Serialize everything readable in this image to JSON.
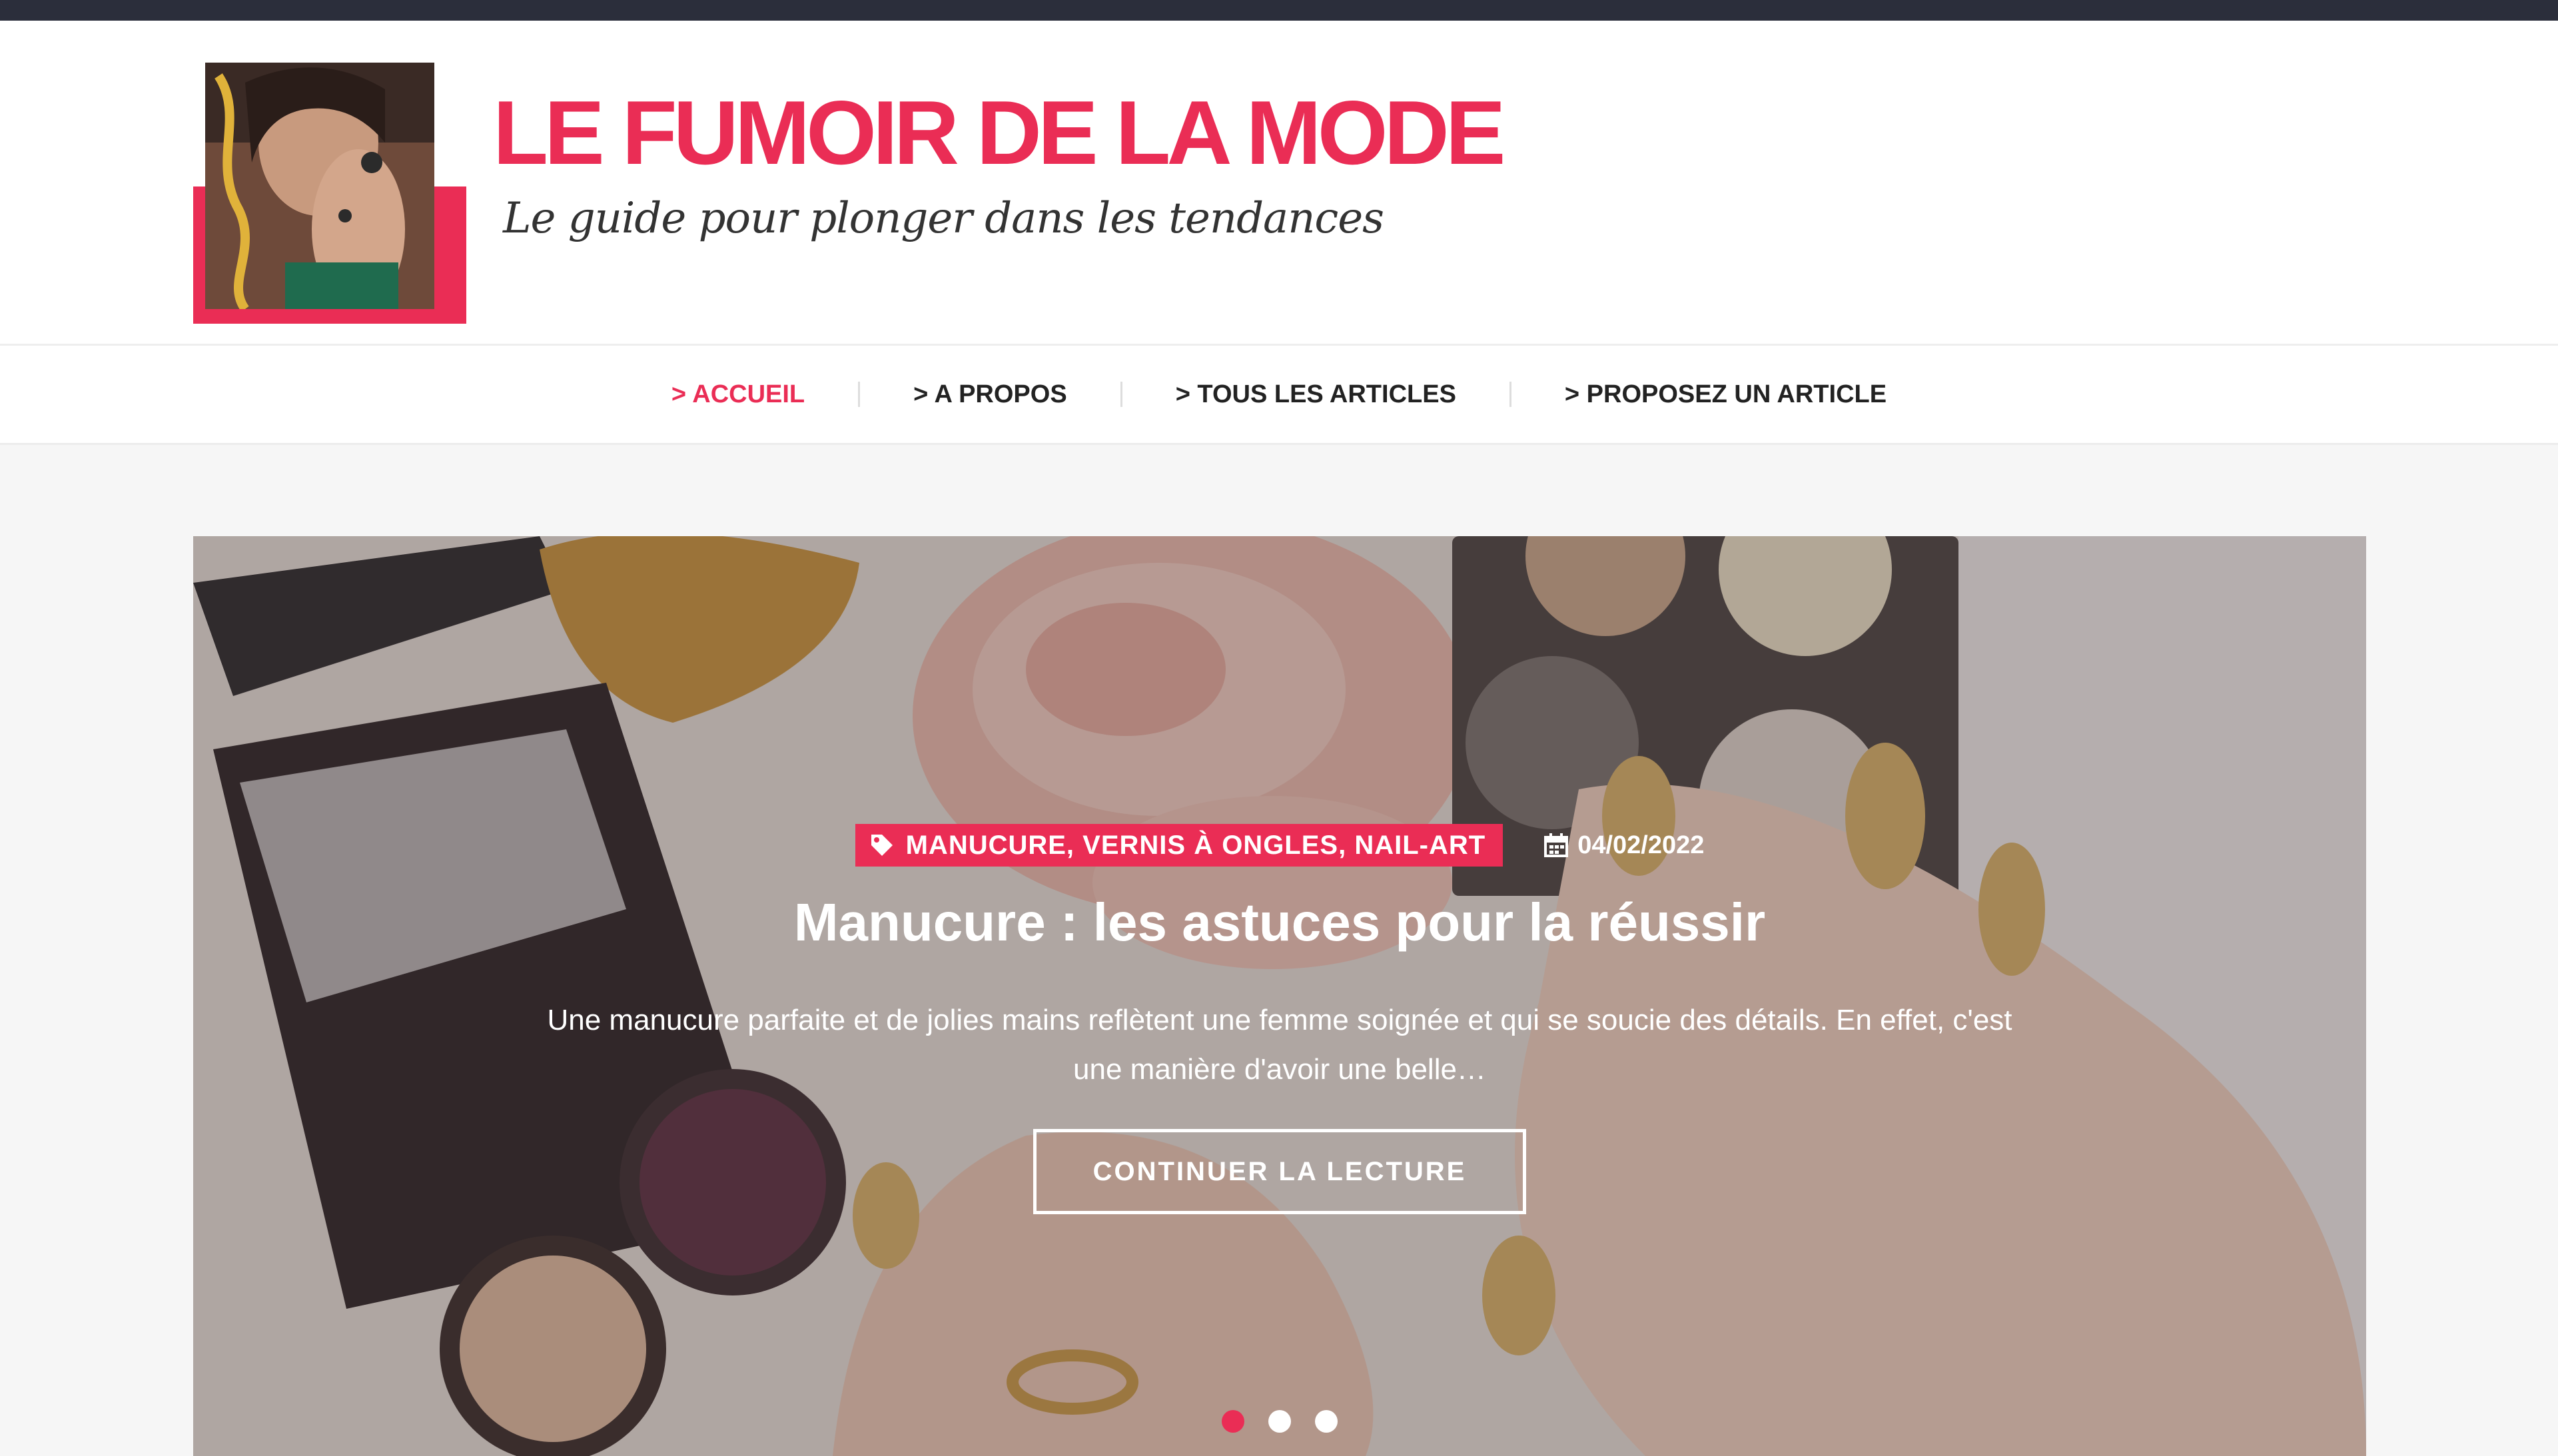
{
  "site": {
    "title": "LE FUMOIR DE LA MODE",
    "tagline": "Le guide pour plonger dans les tendances"
  },
  "nav": {
    "items": [
      {
        "label": "> ACCUEIL",
        "active": true
      },
      {
        "label": "> A PROPOS",
        "active": false
      },
      {
        "label": "> TOUS LES ARTICLES",
        "active": false
      },
      {
        "label": "> PROPOSEZ UN ARTICLE",
        "active": false
      }
    ]
  },
  "slide": {
    "categories": "MANUCURE, VERNIS À ONGLES, NAIL-ART",
    "date": "04/02/2022",
    "title": "Manucure : les astuces pour la réussir",
    "excerpt": "Une manucure parfaite et de jolies mains reflètent une femme soignée et qui se soucie des détails. En effet, c'est une manière d'avoir une belle…",
    "button_label": "CONTINUER LA LECTURE"
  },
  "slider_dots": {
    "count": 3,
    "active_index": 0
  },
  "icons": {
    "tag": "tag-icon",
    "calendar": "calendar-icon"
  },
  "colors": {
    "accent": "#ea2d55",
    "topbar": "#2b2e3b",
    "background": "#f6f6f6"
  }
}
